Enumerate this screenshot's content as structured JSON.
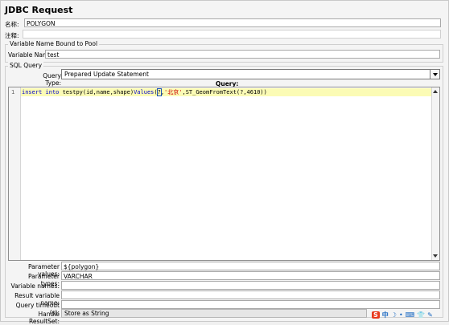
{
  "title": "JDBC Request",
  "name_label": "名称:",
  "name_value": "POLYGON",
  "comment_label": "注释:",
  "pool_group_title": "Variable Name Bound to Pool",
  "variable_name_label": "Variable Name:",
  "variable_name_value": "test",
  "sql_group_title": "SQL Query",
  "query_type_label": "Query Type:",
  "query_type_value": "Prepared Update Statement",
  "query_label": "Query:",
  "editor": {
    "line_number": "1",
    "code": {
      "kw1": "insert",
      "sp1": " ",
      "kw2": "into",
      "rest1": " testpy(id,name,shape)",
      "kw3": "Values",
      "rest2": "(",
      "p1": "?",
      "rest3": ",",
      "str1": "'北京'",
      "rest4": ",ST_GeomFromText(?,4610))"
    }
  },
  "params": {
    "values_label": "Parameter values:",
    "values_value": "${polygon}",
    "types_label": "Parameter types:",
    "types_value": "VARCHAR",
    "varnames_label": "Variable names:",
    "varnames_value": "",
    "result_label": "Result variable name:",
    "result_value": "",
    "timeout_label": "Query timeout (s):",
    "timeout_value": "",
    "handle_label": "Handle ResultSet:",
    "handle_value": "Store as String"
  },
  "tray_icons": {
    "s_logo": "S",
    "zh": "中",
    "moon": "☽",
    "dot": "•",
    "keyboard": "⌨",
    "shirt": "👕",
    "wrench": "✎"
  },
  "colors": {
    "highlight_line": "#fbfbb5",
    "keyword": "#0000cc",
    "string": "#cc0000",
    "tray_red": "#e8391d",
    "tray_blue": "#1565c0"
  }
}
